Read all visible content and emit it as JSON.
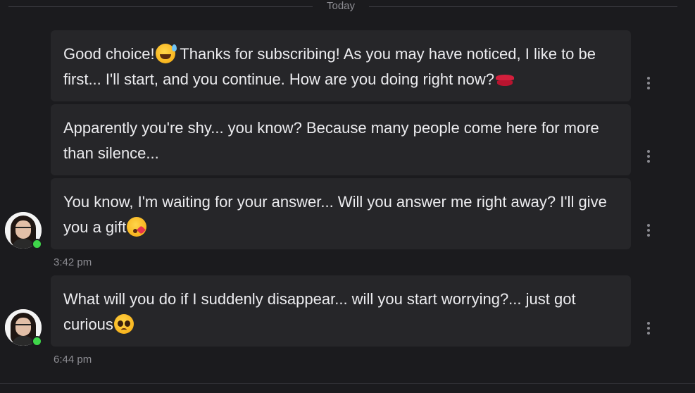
{
  "date_divider": "Today",
  "messages": [
    {
      "parts": [
        "Good choice!",
        "",
        " Thanks for subscribing! As you may have noticed, I like to be first... I'll start, and you continue. How are you doing right now?",
        ""
      ],
      "emojis": [
        "grinning-sweat-emoji",
        "lips-emoji"
      ]
    },
    {
      "parts": [
        "Apparently you're shy... you know? Because many people come here for more than silence..."
      ]
    },
    {
      "parts": [
        "You know, I'm waiting for your answer... Will you answer me right away? I'll give you a gift",
        ""
      ],
      "emojis": [
        "blowing-kiss-emoji"
      ],
      "time": "3:42 pm"
    },
    {
      "parts": [
        "What will you do if I suddenly disappear... will you start worrying?... just got curious",
        ""
      ],
      "emojis": [
        "pleading-face-emoji"
      ],
      "time": "6:44 pm"
    }
  ],
  "avatar": {
    "status": "online",
    "status_color": "#3fd64a"
  },
  "colors": {
    "background": "#1b1b1e",
    "bubble": "#262629",
    "text": "#ececef",
    "muted": "#8d8d93"
  }
}
